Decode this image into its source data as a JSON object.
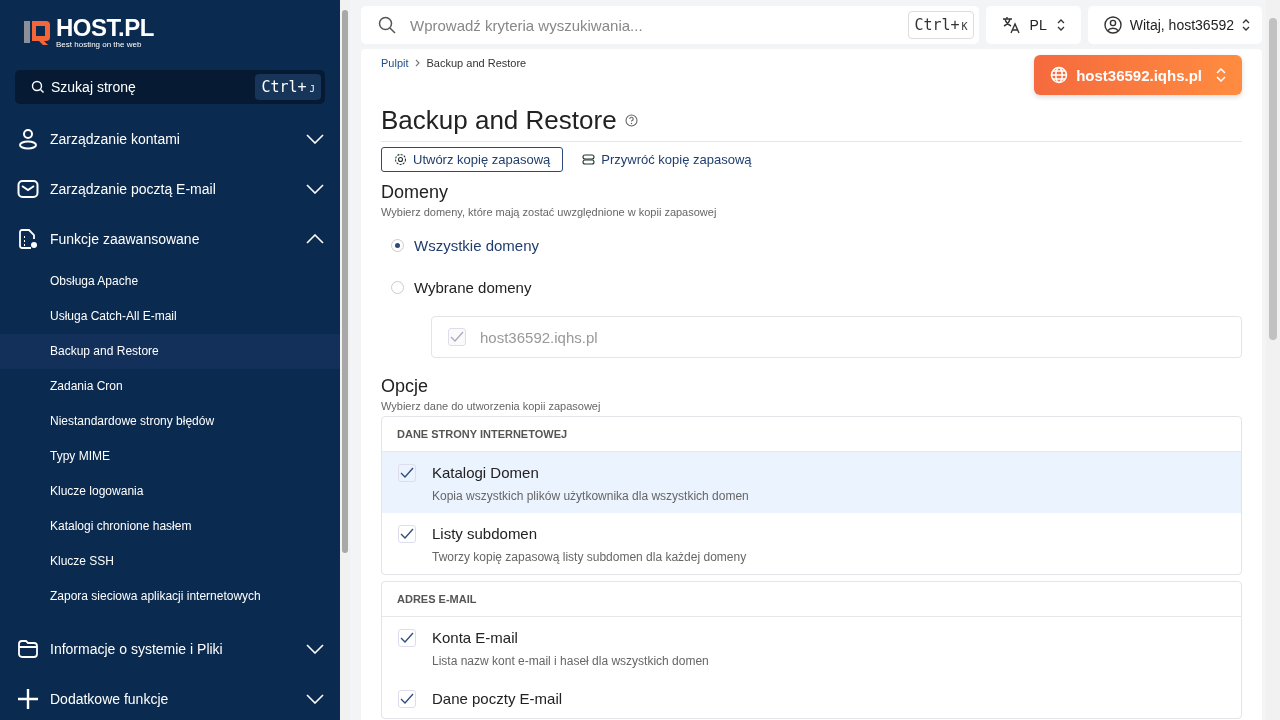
{
  "logo": {
    "name": "HOST.PL",
    "tagline": "Best hosting on the web"
  },
  "sidebar_search": {
    "placeholder": "Szukaj stronę",
    "shortcut_main": "Ctrl+",
    "shortcut_key": "J"
  },
  "sidebar": {
    "groups": [
      {
        "label": "Zarządzanie kontami",
        "expanded": false
      },
      {
        "label": "Zarządzanie pocztą E-mail",
        "expanded": false
      },
      {
        "label": "Funkcje zaawansowane",
        "expanded": true,
        "children": [
          {
            "label": "Obsługa Apache",
            "selected": false
          },
          {
            "label": "Usługa Catch-All E-mail",
            "selected": false
          },
          {
            "label": "Backup and Restore",
            "selected": true
          },
          {
            "label": "Zadania Cron",
            "selected": false
          },
          {
            "label": "Niestandardowe strony błędów",
            "selected": false
          },
          {
            "label": "Typy MIME",
            "selected": false
          },
          {
            "label": "Klucze logowania",
            "selected": false
          },
          {
            "label": "Katalogi chronione hasłem",
            "selected": false
          },
          {
            "label": "Klucze SSH",
            "selected": false
          },
          {
            "label": "Zapora sieciowa aplikacji internetowych",
            "selected": false
          }
        ]
      },
      {
        "label": "Informacje o systemie i Pliki",
        "expanded": false
      },
      {
        "label": "Dodatkowe funkcje",
        "expanded": false
      }
    ]
  },
  "top_search": {
    "placeholder": "Wprowadź kryteria wyszukiwania...",
    "shortcut_main": "Ctrl+",
    "shortcut_key": "K"
  },
  "language": "PL",
  "user": "Witaj, host36592",
  "breadcrumb": [
    "Pulpit",
    "Backup and Restore"
  ],
  "domain_switch": "host36592.iqhs.pl",
  "title": "Backup and Restore",
  "tabs": [
    {
      "label": "Utwórz kopię zapasową",
      "selected": true
    },
    {
      "label": "Przywróć kopię zapasową",
      "selected": false
    }
  ],
  "domains": {
    "heading": "Domeny",
    "hint": "Wybierz domeny, które mają zostać uwzględnione w kopii zapasowej",
    "options": [
      {
        "label": "Wszystkie domeny",
        "selected": true
      },
      {
        "label": "Wybrane domeny",
        "selected": false
      }
    ],
    "list": [
      {
        "label": "host36592.iqhs.pl",
        "checked": true,
        "disabled": true
      }
    ]
  },
  "options": {
    "heading": "Opcje",
    "hint": "Wybierz dane do utworzenia kopii zapasowej",
    "sections": [
      {
        "title": "DANE STRONY INTERNETOWEJ",
        "items": [
          {
            "label": "Katalogi Domen",
            "description": "Kopia wszystkich plików użytkownika dla wszystkich domen",
            "checked": true,
            "selected": true
          },
          {
            "label": "Listy subdomen",
            "description": "Tworzy kopię zapasową listy subdomen dla każdej domeny",
            "checked": true,
            "selected": false
          }
        ]
      },
      {
        "title": "ADRES E-MAIL",
        "items": [
          {
            "label": "Konta E-mail",
            "description": "Lista nazw kont e-mail i haseł dla wszystkich domen",
            "checked": true,
            "selected": false
          },
          {
            "label": "Dane poczty E-mail",
            "checked": true,
            "selected": false
          }
        ]
      }
    ]
  }
}
